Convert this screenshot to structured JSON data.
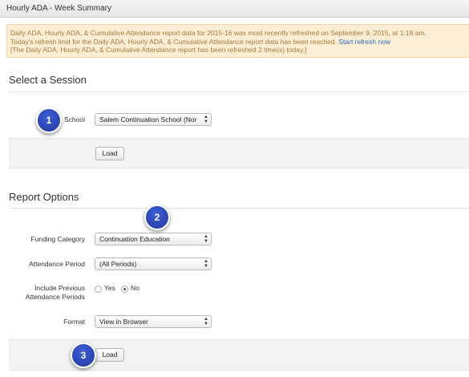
{
  "window": {
    "title": "Hourly ADA - Week Summary"
  },
  "alert": {
    "line1": "Daily ADA, Hourly ADA, & Cumulative Attendance report data for 2015-16 was most recently refreshed on September 9, 2015, at 1:18 am.",
    "line2": "Today's refresh limit for the Daily ADA, Hourly ADA, & Cumulative Attendance report data has been reached.",
    "link": "Start refresh now",
    "line3": "[The Daily ADA, Hourly ADA, & Cumulative Attendance report has been refreshed 2 time(s) today.]"
  },
  "session": {
    "heading": "Select a Session",
    "school_label": "School",
    "school_value": "Salem Continuation School (Nor",
    "load_label": "Load"
  },
  "report": {
    "heading": "Report Options",
    "funding_label": "Funding Category",
    "funding_value": "Continuation Education",
    "period_label": "Attendance Period",
    "period_value": "(All Periods)",
    "include_label_1": "Include Previous",
    "include_label_2": "Attendance Periods",
    "yes_label": "Yes",
    "no_label": "No",
    "include_selected": "No",
    "format_label": "Format",
    "format_value": "View in Browser",
    "load_label": "Load"
  },
  "callouts": [
    "1",
    "2",
    "3"
  ]
}
